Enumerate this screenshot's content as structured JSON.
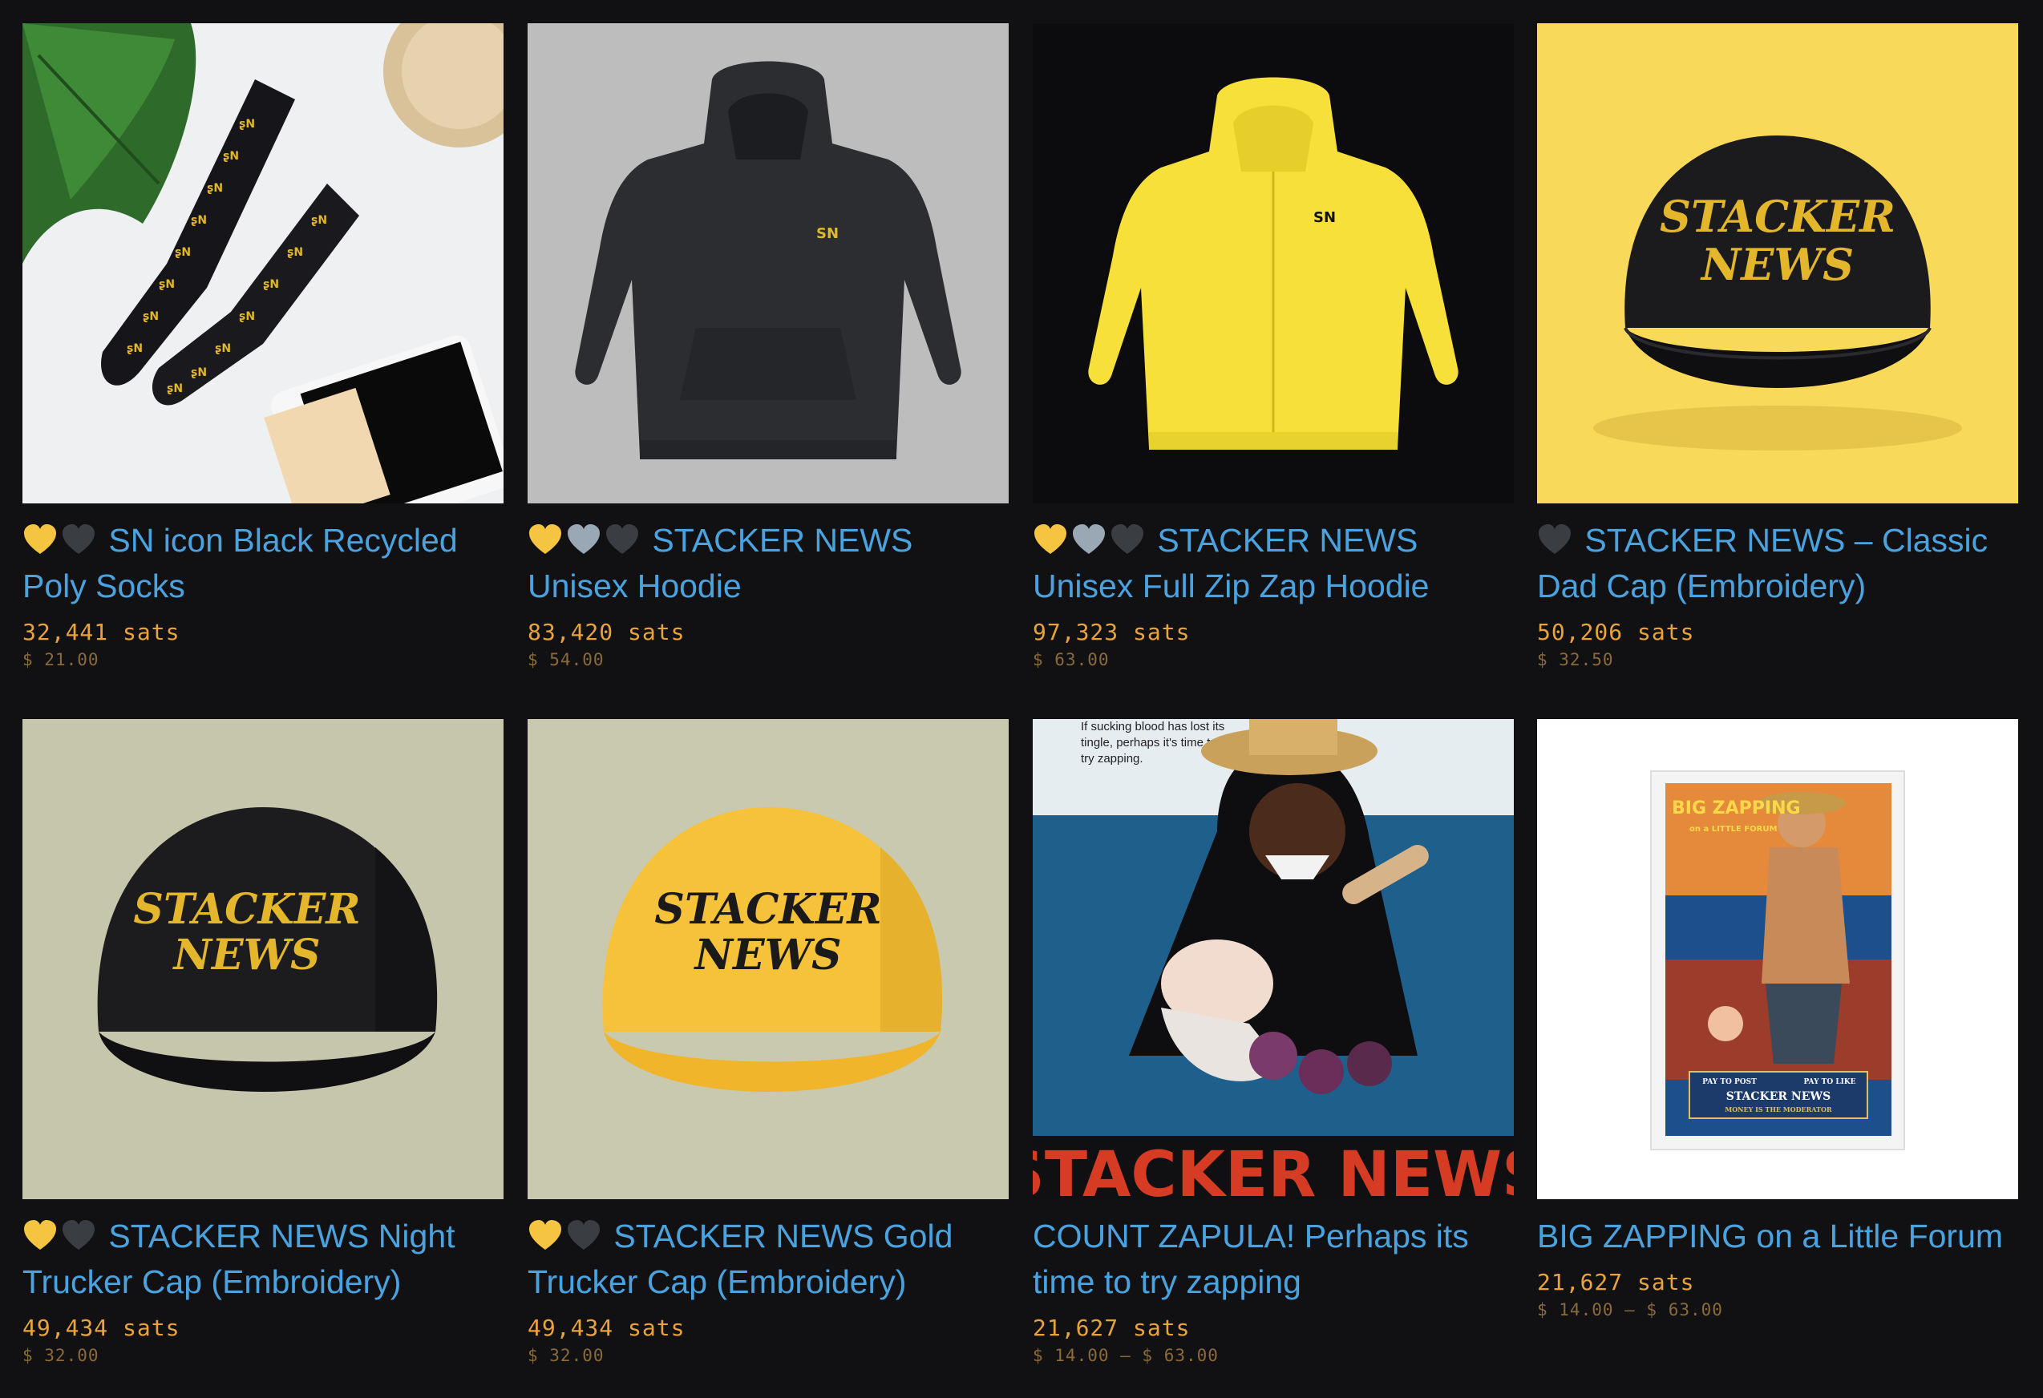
{
  "colors": {
    "background": "#111114",
    "title_link": "#4aa3df",
    "sats": "#e8a33d",
    "usd": "#8a6a3a",
    "heart_gold": "#f5c542",
    "heart_silver": "#9aa7b4",
    "heart_dark": "#3a3d42"
  },
  "products": [
    {
      "hearts": [
        "heart-gold-icon",
        "heart-dark-icon"
      ],
      "title": "SN icon Black Recycled Poly Socks",
      "sats": "32,441 sats",
      "usd": "$ 21.00",
      "image": "black-socks-photo"
    },
    {
      "hearts": [
        "heart-gold-icon",
        "heart-silver-icon",
        "heart-dark-icon"
      ],
      "title": "STACKER NEWS Unisex Hoodie",
      "sats": "83,420 sats",
      "usd": "$ 54.00",
      "image": "black-hoodie-photo"
    },
    {
      "hearts": [
        "heart-gold-icon",
        "heart-silver-icon",
        "heart-dark-icon"
      ],
      "title": "STACKER NEWS Unisex Full Zip Zap Hoodie",
      "sats": "97,323 sats",
      "usd": "$ 63.00",
      "image": "yellow-zip-hoodie-photo"
    },
    {
      "hearts": [
        "heart-dark-icon"
      ],
      "title": "STACKER NEWS – Classic Dad Cap (Embroidery)",
      "sats": "50,206 sats",
      "usd": "$ 32.50",
      "image": "black-dad-cap-photo"
    },
    {
      "hearts": [
        "heart-gold-icon",
        "heart-dark-icon"
      ],
      "title": "STACKER NEWS Night Trucker Cap (Embroidery)",
      "sats": "49,434 sats",
      "usd": "$ 32.00",
      "image": "black-trucker-cap-photo"
    },
    {
      "hearts": [
        "heart-gold-icon",
        "heart-dark-icon"
      ],
      "title": "STACKER NEWS Gold Trucker Cap (Embroidery)",
      "sats": "49,434 sats",
      "usd": "$ 32.00",
      "image": "gold-trucker-cap-photo"
    },
    {
      "hearts": [],
      "title": "COUNT ZAPULA! Perhaps its time to try zapping",
      "sats": "21,627 sats",
      "usd": "$ 14.00 — $ 63.00",
      "image": "count-zapula-poster",
      "poster_text": "If sucking blood has lost its tingle, perhaps it's time to try zapping.",
      "poster_title": "STACKER NEWS"
    },
    {
      "hearts": [],
      "title": "BIG ZAPPING on a Little Forum",
      "sats": "21,627 sats",
      "usd": "$ 14.00 — $ 63.00",
      "image": "big-zapping-poster",
      "poster_title": "BIG ZAPPING",
      "poster_subtitle": "on a LITTLE FORUM",
      "poster_tagline_left": "PAY TO POST",
      "poster_tagline_right": "PAY TO LIKE",
      "poster_brand": "STACKER NEWS",
      "poster_footer": "MONEY IS THE MODERATOR"
    }
  ],
  "cap_text": {
    "line1": "STACKER",
    "line2": "NEWS"
  },
  "logo_text": "SN"
}
